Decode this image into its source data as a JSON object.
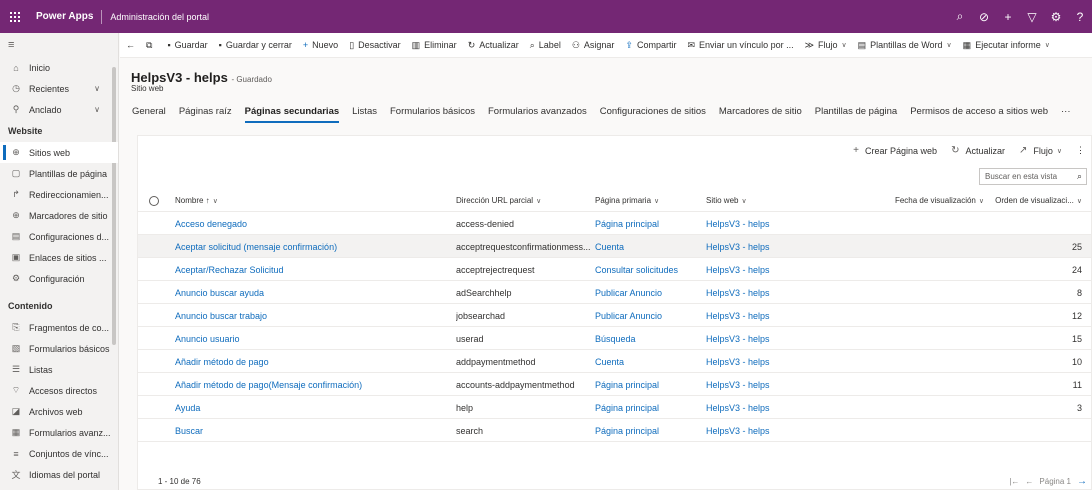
{
  "topbar": {
    "app_name": "Power Apps",
    "portal_title": "Administración del portal",
    "icons": [
      "search-icon",
      "task-icon",
      "plus-icon",
      "filter-icon",
      "gear-icon",
      "help-icon"
    ]
  },
  "sidebar": {
    "top_items": [
      {
        "label": "Inicio",
        "icon": "home-icon"
      },
      {
        "label": "Recientes",
        "icon": "clock-icon"
      },
      {
        "label": "Anclado",
        "icon": "pin-icon"
      }
    ],
    "section_website": "Website",
    "website_items": [
      {
        "label": "Sitios web",
        "icon": "globe-icon"
      },
      {
        "label": "Plantillas de página",
        "icon": "page-icon"
      },
      {
        "label": "Redireccionamien...",
        "icon": "redirect-icon"
      },
      {
        "label": "Marcadores de sitio",
        "icon": "globe-icon"
      },
      {
        "label": "Configuraciones d...",
        "icon": "settings-list-icon"
      },
      {
        "label": "Enlaces de sitios ...",
        "icon": "link-icon"
      },
      {
        "label": "Configuración",
        "icon": "gear-icon"
      }
    ],
    "section_content": "Contenido",
    "content_items": [
      {
        "label": "Fragmentos de co...",
        "icon": "snippet-icon"
      },
      {
        "label": "Formularios básicos",
        "icon": "form-icon"
      },
      {
        "label": "Listas",
        "icon": "list-icon"
      },
      {
        "label": "Accesos directos",
        "icon": "shortcut-icon"
      },
      {
        "label": "Archivos web",
        "icon": "file-icon"
      },
      {
        "label": "Formularios avanz...",
        "icon": "form-icon"
      },
      {
        "label": "Conjuntos de vínc...",
        "icon": "menu-icon"
      },
      {
        "label": "Idiomas del portal",
        "icon": "language-icon"
      }
    ]
  },
  "cmdbar": {
    "back": "←",
    "items": [
      {
        "label": "Guardar",
        "icon": "save-icon"
      },
      {
        "label": "Guardar y cerrar",
        "icon": "save-close-icon"
      },
      {
        "label": "Nuevo",
        "icon": "plus-icon"
      },
      {
        "label": "Desactivar",
        "icon": "deactivate-icon"
      },
      {
        "label": "Eliminar",
        "icon": "trash-icon"
      },
      {
        "label": "Actualizar",
        "icon": "refresh-icon"
      },
      {
        "label": "Label",
        "icon": "label-icon"
      },
      {
        "label": "Asignar",
        "icon": "assign-icon"
      },
      {
        "label": "Compartir",
        "icon": "share-icon"
      },
      {
        "label": "Enviar un vínculo por ...",
        "icon": "email-link-icon"
      },
      {
        "label": "Flujo",
        "icon": "flow-icon"
      },
      {
        "label": "Plantillas de Word",
        "icon": "word-icon"
      },
      {
        "label": "Ejecutar informe",
        "icon": "report-icon"
      }
    ]
  },
  "header": {
    "title": "HelpsV3 - helps",
    "saved": "- Guardado",
    "entity": "Sitio web",
    "tabs": [
      "General",
      "Páginas raíz",
      "Páginas secundarias",
      "Listas",
      "Formularios básicos",
      "Formularios avanzados",
      "Configuraciones de sitios",
      "Marcadores de sitio",
      "Plantillas de página",
      "Permisos de acceso a sitios web",
      "···"
    ],
    "active_tab": "Páginas secundarias"
  },
  "grid": {
    "toolbar": {
      "create": "Crear Página web",
      "refresh": "Actualizar",
      "flow": "Flujo",
      "more": "⋮"
    },
    "search_placeholder": "Buscar en esta vista",
    "columns": [
      "Nombre ↑",
      "Dirección URL parcial",
      "Página primaria",
      "Sitio web",
      "Fecha de visualización",
      "Orden de visualizaci..."
    ],
    "rows": [
      {
        "name": "Acceso denegado",
        "url": "access-denied",
        "parent": "Página principal",
        "site": "HelpsV3 - helps",
        "date": "",
        "order": ""
      },
      {
        "name": "Aceptar solicitud (mensaje confirmación)",
        "url": "acceptrequestconfirmationmess...",
        "parent": "Cuenta",
        "site": "HelpsV3 - helps",
        "date": "",
        "order": "25"
      },
      {
        "name": "Aceptar/Rechazar Solicitud",
        "url": "acceptrejectrequest",
        "parent": "Consultar solicitudes",
        "site": "HelpsV3 - helps",
        "date": "",
        "order": "24"
      },
      {
        "name": "Anuncio buscar ayuda",
        "url": "adSearchhelp",
        "parent": "Publicar Anuncio",
        "site": "HelpsV3 - helps",
        "date": "",
        "order": "8"
      },
      {
        "name": "Anuncio buscar trabajo",
        "url": "jobsearchad",
        "parent": "Publicar Anuncio",
        "site": "HelpsV3 - helps",
        "date": "",
        "order": "12"
      },
      {
        "name": "Anuncio usuario",
        "url": "userad",
        "parent": "Búsqueda",
        "site": "HelpsV3 - helps",
        "date": "",
        "order": "15"
      },
      {
        "name": "Añadir método de pago",
        "url": "addpaymentmethod",
        "parent": "Cuenta",
        "site": "HelpsV3 - helps",
        "date": "",
        "order": "10"
      },
      {
        "name": "Añadir método de pago(Mensaje confirmación)",
        "url": "accounts-addpaymentmethod",
        "parent": "Página principal",
        "site": "HelpsV3 - helps",
        "date": "",
        "order": "11"
      },
      {
        "name": "Ayuda",
        "url": "help",
        "parent": "Página principal",
        "site": "HelpsV3 - helps",
        "date": "",
        "order": "3"
      },
      {
        "name": "Buscar",
        "url": "search",
        "parent": "Página principal",
        "site": "HelpsV3 - helps",
        "date": "",
        "order": ""
      }
    ],
    "footer_count": "1 - 10 de 76",
    "page_label": "Página 1"
  }
}
